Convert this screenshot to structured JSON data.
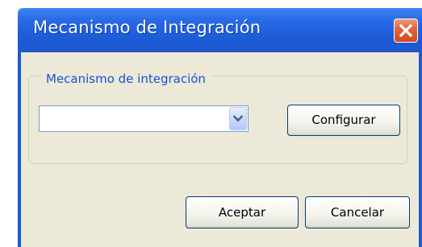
{
  "dialog": {
    "title": "Mecanismo de Integración",
    "close_icon": "close-icon",
    "group_label": "Mecanismo de integración",
    "select_value": "",
    "select_icon": "chevron-down-icon",
    "configure_label": "Configurar",
    "accept_label": "Aceptar",
    "cancel_label": "Cancelar"
  },
  "colors": {
    "titlebar": "#1f5fdc",
    "window_background": "#ece9d8",
    "group_label_text": "#1b4fd6",
    "close_button": "#e4653e",
    "button_border": "#003c74"
  }
}
